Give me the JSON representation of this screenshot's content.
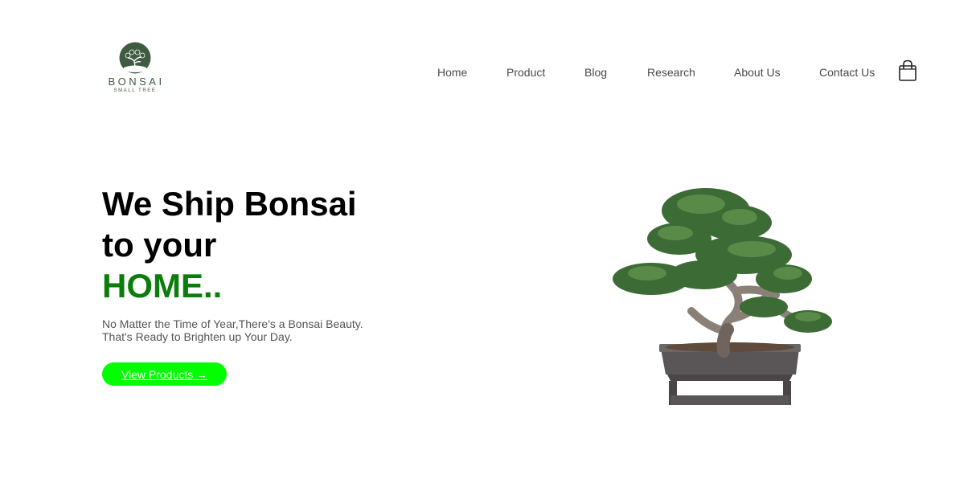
{
  "brand": {
    "name": "BONSAI",
    "tagline": "SMALL TREE",
    "color": "#3f5b41"
  },
  "nav": {
    "items": [
      {
        "label": "Home"
      },
      {
        "label": "Product"
      },
      {
        "label": "Blog"
      },
      {
        "label": "Research"
      },
      {
        "label": "About Us"
      },
      {
        "label": "Contact Us"
      }
    ],
    "cart_icon": "shopping-bag-icon"
  },
  "hero": {
    "headline_line1": "We Ship Bonsai",
    "headline_line2": "to your",
    "headline_accent": "HOME..",
    "accent_color": "#0a7d0a",
    "subtext_line1": "No Matter the Time of Year,There's a Bonsai Beauty.",
    "subtext_line2": "That's Ready to Brighten up Your Day.",
    "cta_label": "View Products →",
    "cta_color": "#00ff00"
  }
}
